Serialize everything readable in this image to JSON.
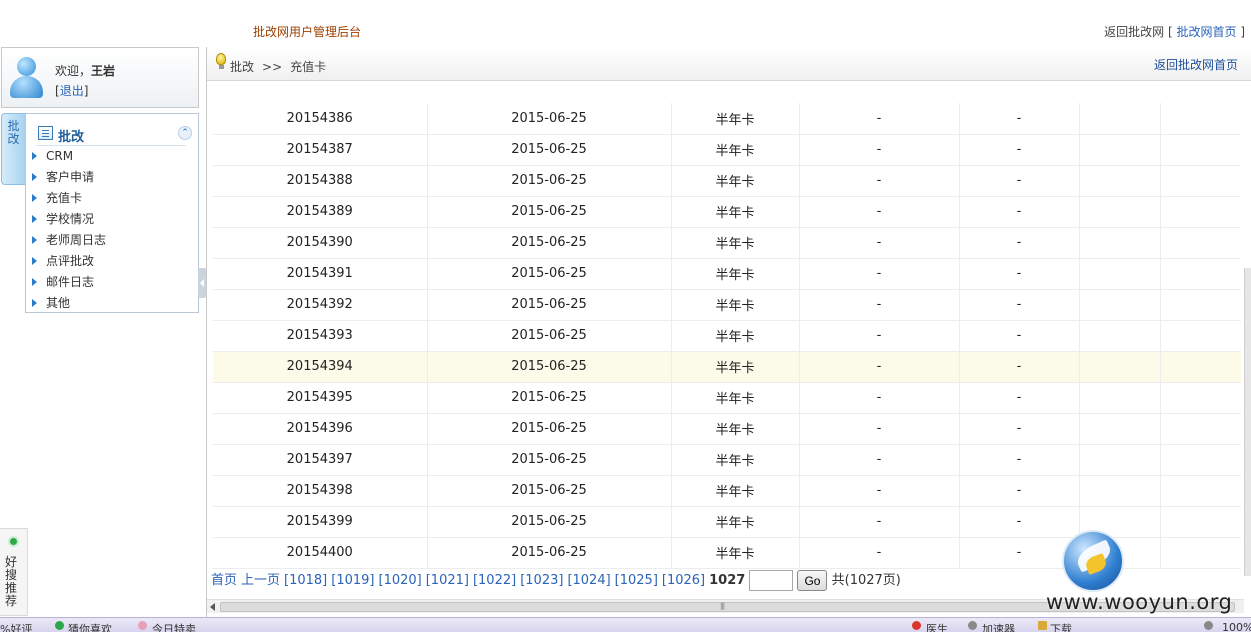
{
  "header": {
    "title": "批改网用户管理后台",
    "return_text": "返回批改网",
    "return_link": "批改网首页"
  },
  "user": {
    "welcome": "欢迎，",
    "name": "王岩",
    "logout": "退出"
  },
  "side_tab": {
    "label": "批改"
  },
  "menu": {
    "title": "批改",
    "items": [
      {
        "label": "CRM"
      },
      {
        "label": "客户申请"
      },
      {
        "label": "充值卡"
      },
      {
        "label": "学校情况"
      },
      {
        "label": "老师周日志"
      },
      {
        "label": "点评批改"
      },
      {
        "label": "邮件日志"
      },
      {
        "label": "其他"
      }
    ]
  },
  "breadcrumb": {
    "root": "批改",
    "sep": ">>",
    "current": "充值卡",
    "home_link": "返回批改网首页"
  },
  "table": {
    "highlighted_index": 8,
    "rows": [
      [
        "20154386",
        "2015-06-25",
        "半年卡",
        "-",
        "-",
        "",
        ""
      ],
      [
        "20154387",
        "2015-06-25",
        "半年卡",
        "-",
        "-",
        "",
        ""
      ],
      [
        "20154388",
        "2015-06-25",
        "半年卡",
        "-",
        "-",
        "",
        ""
      ],
      [
        "20154389",
        "2015-06-25",
        "半年卡",
        "-",
        "-",
        "",
        ""
      ],
      [
        "20154390",
        "2015-06-25",
        "半年卡",
        "-",
        "-",
        "",
        ""
      ],
      [
        "20154391",
        "2015-06-25",
        "半年卡",
        "-",
        "-",
        "",
        ""
      ],
      [
        "20154392",
        "2015-06-25",
        "半年卡",
        "-",
        "-",
        "",
        ""
      ],
      [
        "20154393",
        "2015-06-25",
        "半年卡",
        "-",
        "-",
        "",
        ""
      ],
      [
        "20154394",
        "2015-06-25",
        "半年卡",
        "-",
        "-",
        "",
        ""
      ],
      [
        "20154395",
        "2015-06-25",
        "半年卡",
        "-",
        "-",
        "",
        ""
      ],
      [
        "20154396",
        "2015-06-25",
        "半年卡",
        "-",
        "-",
        "",
        ""
      ],
      [
        "20154397",
        "2015-06-25",
        "半年卡",
        "-",
        "-",
        "",
        ""
      ],
      [
        "20154398",
        "2015-06-25",
        "半年卡",
        "-",
        "-",
        "",
        ""
      ],
      [
        "20154399",
        "2015-06-25",
        "半年卡",
        "-",
        "-",
        "",
        ""
      ],
      [
        "20154400",
        "2015-06-25",
        "半年卡",
        "-",
        "-",
        "",
        ""
      ]
    ]
  },
  "pager": {
    "first": "首页",
    "prev": "上一页",
    "pages": [
      "[1018]",
      "[1019]",
      "[1020]",
      "[1021]",
      "[1022]",
      "[1023]",
      "[1024]",
      "[1025]",
      "[1026]"
    ],
    "current": "1027",
    "input_value": "",
    "go": "Go",
    "total": "共(1027页)"
  },
  "side_widget": {
    "label": "好搜推荐"
  },
  "watermark": {
    "text": "www.wooyun.org"
  },
  "taskbar": {
    "items": [
      "%好评",
      "猜你喜欢",
      "今日特卖",
      "医生",
      "加速器",
      "下载",
      "100%"
    ]
  },
  "colors": {
    "accent_blue": "#2a63b8",
    "title_orange": "#a04000",
    "highlight_row": "#fcfbea"
  }
}
